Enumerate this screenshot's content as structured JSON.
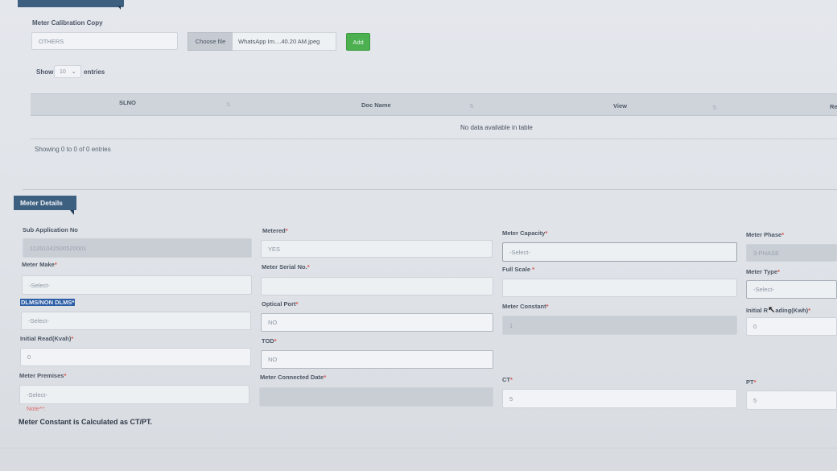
{
  "calibration": {
    "section_label": "Meter Calibration Copy",
    "doc_type": "OTHERS",
    "choose_file_label": "Choose file",
    "file_name": "WhatsApp Im....40.20 AM.jpeg",
    "add_label": "Add"
  },
  "table": {
    "show_label": "Show",
    "entries_value": "10",
    "entries_label": "entries",
    "columns": [
      "SLNO",
      "Doc Name",
      "View",
      "Re"
    ],
    "empty_message": "No data available in table",
    "info": "Showing 0 to 0 of 0 entries"
  },
  "meter": {
    "section_title": "Meter Details",
    "fields": {
      "sub_app_no": {
        "label": "Sub Application No",
        "value": "11261042500520001"
      },
      "metered": {
        "label": "Metered",
        "value": "YES"
      },
      "meter_capacity": {
        "label": "Meter Capacity",
        "value": "-Select-"
      },
      "meter_phase": {
        "label": "Meter Phase",
        "value": "3-PHASE"
      },
      "meter_make": {
        "label": "Meter Make",
        "value": "-Select-"
      },
      "meter_serial": {
        "label": "Meter Serial No.",
        "value": ""
      },
      "full_scale": {
        "label": "Full Scale",
        "value": ""
      },
      "meter_type": {
        "label": "Meter Type",
        "value": "-Select-"
      },
      "dlms": {
        "label": "DLMS/NON DLMS",
        "value": "-Select-"
      },
      "optical_port": {
        "label": "Optical Port",
        "value": "NO"
      },
      "meter_constant": {
        "label": "Meter Constant",
        "value": "1"
      },
      "initial_reading_kwh": {
        "label_a": "Initial R",
        "label_b": "ading(Kwh)",
        "value": "0"
      },
      "initial_read_kvah": {
        "label": "Initial Read(Kvah)",
        "value": "0"
      },
      "tod": {
        "label": "TOD",
        "value": "NO"
      },
      "meter_premises": {
        "label": "Meter Premises",
        "value": "-Select-"
      },
      "meter_connected_date": {
        "label": "Meter Connected Date",
        "value": ""
      },
      "ct": {
        "label": "CT",
        "value": "5"
      },
      "pt": {
        "label": "PT",
        "value": "5"
      }
    },
    "required_mark": "*",
    "note_label": "Note**:",
    "note_text": "Meter Constant is Calculated as CT/PT."
  },
  "colors": {
    "section_tab": "#3d5f80",
    "add_button": "#4caf50",
    "required": "#d9534f"
  }
}
